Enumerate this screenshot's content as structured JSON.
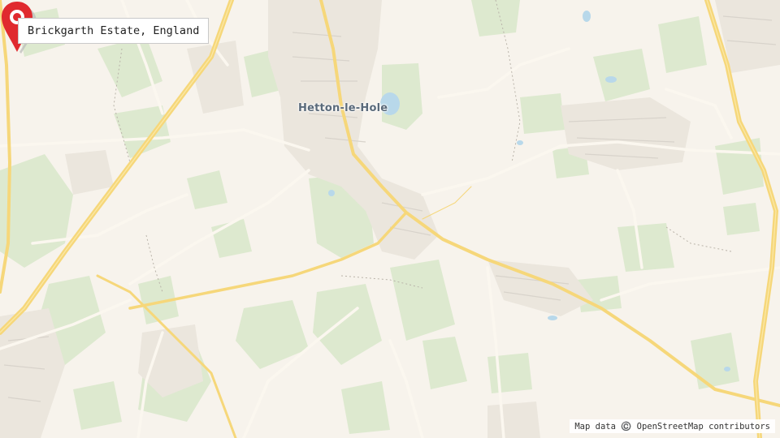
{
  "location": {
    "label": "Brickgarth Estate, England"
  },
  "map": {
    "place_label": "Hetton-le-Hole",
    "attribution": "Map data ©️ OpenStreetMap contributors",
    "colors": {
      "background": "#f7f3ec",
      "green": "#dde9cf",
      "urban": "#ebe6dd",
      "building": "#d8d3cb",
      "road_major": "#f6d77a",
      "road_minor": "#fbf7ef",
      "water": "#b8d8ea",
      "pin": "#e02a2f"
    }
  },
  "marker": {
    "icon": "map-pin-icon"
  }
}
